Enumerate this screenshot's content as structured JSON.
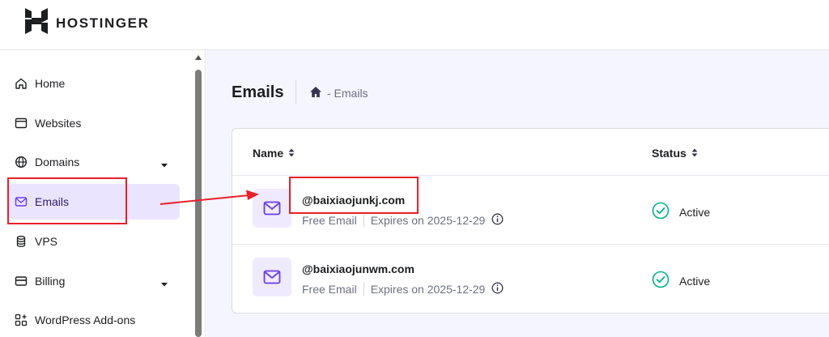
{
  "brand": {
    "name": "HOSTINGER"
  },
  "sidebar": {
    "items": [
      {
        "label": "Home",
        "icon": "home-icon"
      },
      {
        "label": "Websites",
        "icon": "browser-window-icon"
      },
      {
        "label": "Domains",
        "icon": "globe-icon",
        "has_submenu": true
      },
      {
        "label": "Emails",
        "icon": "mail-icon",
        "active": true
      },
      {
        "label": "VPS",
        "icon": "server-stack-icon"
      },
      {
        "label": "Billing",
        "icon": "credit-card-icon",
        "has_submenu": true
      },
      {
        "label": "WordPress Add-ons",
        "icon": "grid-plus-icon"
      }
    ]
  },
  "page": {
    "title": "Emails",
    "breadcrumb": {
      "home_icon": "home-filled-icon",
      "current": "- Emails"
    }
  },
  "table": {
    "columns": {
      "name": "Name",
      "status": "Status"
    },
    "rows": [
      {
        "address": "@baixiaojunkj.com",
        "plan": "Free Email",
        "expiry": "Expires on 2025-12-29",
        "status": "Active"
      },
      {
        "address": "@baixiaojunwm.com",
        "plan": "Free Email",
        "expiry": "Expires on 2025-12-29",
        "status": "Active"
      }
    ]
  },
  "colors": {
    "accent": "#673de6",
    "active_bg": "#ebe4ff",
    "status_ok": "#00b090",
    "annotation": "#e8202a"
  }
}
